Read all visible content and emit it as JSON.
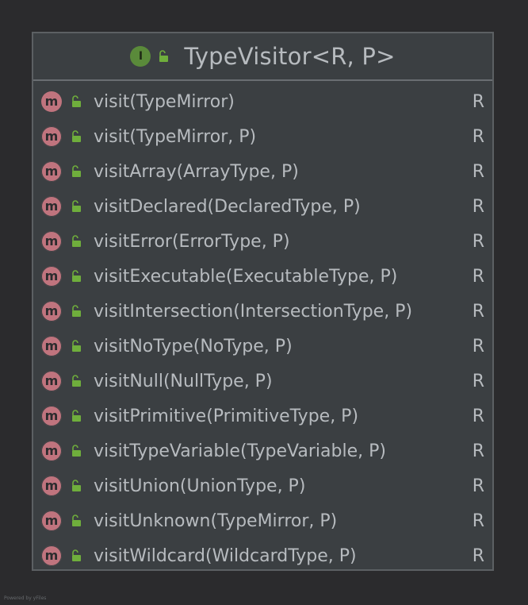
{
  "class": {
    "title": "TypeVisitor<R, P>",
    "stereotype_icon": "I",
    "method_icon": "m",
    "colors": {
      "background": "#2b2b2d",
      "box": "#3b3f42",
      "border": "#5c6063",
      "text": "#b7bbbf",
      "interface_icon": "#5a8a3a",
      "method_icon": "#c0747e",
      "lock_icon": "#6fae3c"
    }
  },
  "methods": [
    {
      "name": "visit(TypeMirror)",
      "return": "R"
    },
    {
      "name": "visit(TypeMirror, P)",
      "return": "R"
    },
    {
      "name": "visitArray(ArrayType, P)",
      "return": "R"
    },
    {
      "name": "visitDeclared(DeclaredType, P)",
      "return": "R"
    },
    {
      "name": "visitError(ErrorType, P)",
      "return": "R"
    },
    {
      "name": "visitExecutable(ExecutableType, P)",
      "return": "R"
    },
    {
      "name": "visitIntersection(IntersectionType, P)",
      "return": "R"
    },
    {
      "name": "visitNoType(NoType, P)",
      "return": "R"
    },
    {
      "name": "visitNull(NullType, P)",
      "return": "R"
    },
    {
      "name": "visitPrimitive(PrimitiveType, P)",
      "return": "R"
    },
    {
      "name": "visitTypeVariable(TypeVariable, P)",
      "return": "R"
    },
    {
      "name": "visitUnion(UnionType, P)",
      "return": "R"
    },
    {
      "name": "visitUnknown(TypeMirror, P)",
      "return": "R"
    },
    {
      "name": "visitWildcard(WildcardType, P)",
      "return": "R"
    }
  ],
  "footer": {
    "text": "Powered by yFiles"
  }
}
